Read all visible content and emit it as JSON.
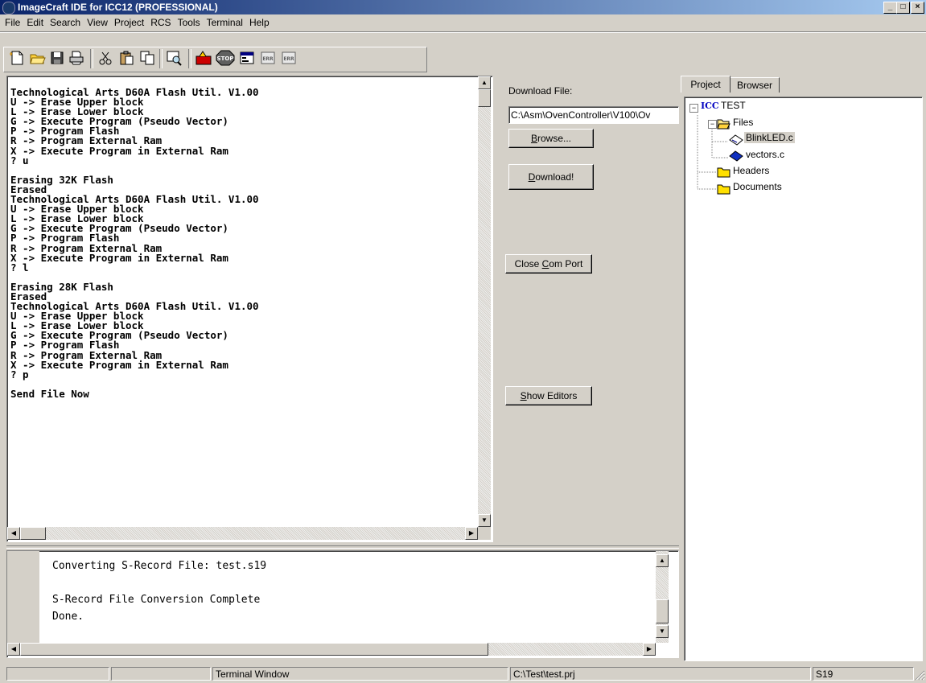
{
  "window": {
    "title": "ImageCraft IDE for ICC12 (PROFESSIONAL)"
  },
  "menu": [
    "File",
    "Edit",
    "Search",
    "View",
    "Project",
    "RCS",
    "Tools",
    "Terminal",
    "Help"
  ],
  "toolbar": {
    "icons": [
      "new-file-icon",
      "open-folder-icon",
      "save-icon",
      "print-icon",
      "cut-icon",
      "paste-icon",
      "copy-icon",
      "find-icon",
      "build-icon",
      "stop-icon",
      "compile-icon",
      "error-prev-icon",
      "error-next-icon"
    ],
    "stop_label": "STOP",
    "err_label_1": "ERR",
    "err_label_2": "ERR"
  },
  "terminal": {
    "text": "Technological Arts D60A Flash Util. V1.00\nU -> Erase Upper block\nL -> Erase Lower block\nG -> Execute Program (Pseudo Vector)\nP -> Program Flash\nR -> Program External Ram\nX -> Execute Program in External Ram\n? u\n\nErasing 32K Flash\nErased\nTechnological Arts D60A Flash Util. V1.00\nU -> Erase Upper block\nL -> Erase Lower block\nG -> Execute Program (Pseudo Vector)\nP -> Program Flash\nR -> Program External Ram\nX -> Execute Program in External Ram\n? l\n\nErasing 28K Flash\nErased\nTechnological Arts D60A Flash Util. V1.00\nU -> Erase Upper block\nL -> Erase Lower block\nG -> Execute Program (Pseudo Vector)\nP -> Program Flash\nR -> Program External Ram\nX -> Execute Program in External Ram\n? p\n\nSend File Now"
  },
  "download_panel": {
    "label": "Download File:",
    "path": "C:\\Asm\\OvenController\\V100\\Ov",
    "browse": {
      "pre": "",
      "key": "B",
      "post": "rowse..."
    },
    "download": {
      "pre": "",
      "key": "D",
      "post": "ownload!"
    },
    "close_port": {
      "pre": "Close ",
      "key": "C",
      "post": "om Port"
    },
    "show_editors": {
      "pre": "",
      "key": "S",
      "post": "how Editors"
    }
  },
  "project": {
    "tabs": [
      "Project",
      "Browser"
    ],
    "root_badge": "ICC",
    "root": "TEST",
    "files_folder": "Files",
    "files": [
      "BlinkLED.c",
      "vectors.c"
    ],
    "headers": "Headers",
    "documents": "Documents"
  },
  "output": {
    "lines": [
      "Converting S-Record File: test.s19",
      "",
      "S-Record File Conversion Complete",
      "Done."
    ]
  },
  "status": {
    "pane1": "",
    "pane2": "",
    "pane3": "Terminal Window",
    "pane4": "C:\\Test\\test.prj",
    "pane5": "S19"
  }
}
